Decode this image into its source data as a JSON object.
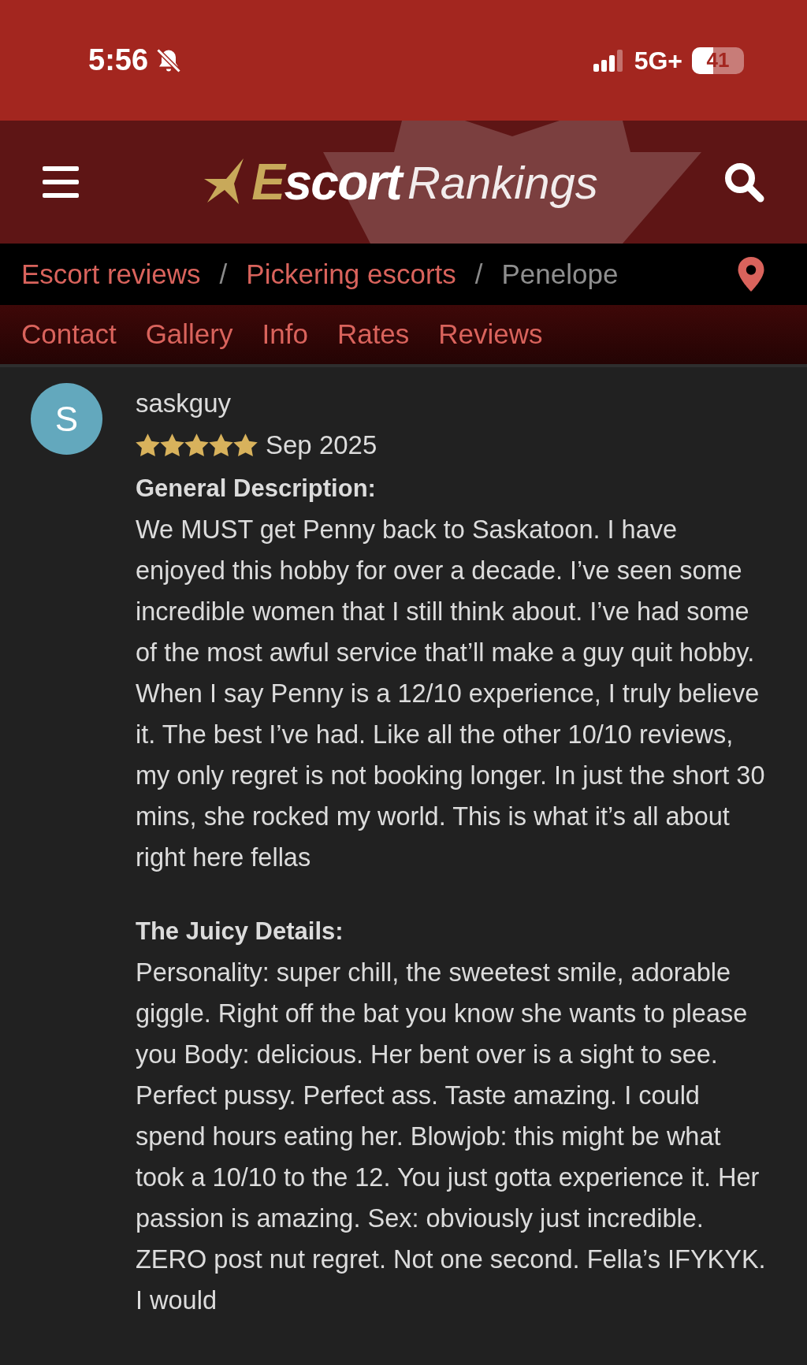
{
  "status_bar": {
    "time": "5:56",
    "network": "5G+",
    "battery": "41"
  },
  "header": {
    "logo_bold": "Escort",
    "logo_light": "Rankings"
  },
  "breadcrumbs": [
    {
      "label": "Escort reviews",
      "current": false
    },
    {
      "label": "Pickering escorts",
      "current": false
    },
    {
      "label": "Penelope",
      "current": true
    }
  ],
  "breadcrumb_separator": "/",
  "tabs": [
    {
      "label": "Contact"
    },
    {
      "label": "Gallery"
    },
    {
      "label": "Info"
    },
    {
      "label": "Rates"
    },
    {
      "label": "Reviews"
    }
  ],
  "review": {
    "avatar_letter": "S",
    "author": "saskguy",
    "stars": 5,
    "date": "Sep 2025",
    "sections": [
      {
        "heading": "General Description:",
        "body": "We MUST get Penny back to Saskatoon. I have enjoyed this hobby for over a decade. I’ve seen some incredible women that I still think about. I’ve had some of the most awful service that’ll make a guy quit hobby. When I say Penny is a 12/10 experience, I truly believe it. The best I’ve had. Like all the other 10/10 reviews, my only regret is not booking longer. In just the short 30 mins, she rocked my world. This is what it’s all about right here fellas"
      },
      {
        "heading": "The Juicy Details:",
        "body": "Personality: super chill, the sweetest smile, adorable giggle. Right off the bat you know she wants to please you Body: delicious. Her bent over is a sight to see. Perfect pussy. Perfect ass. Taste amazing. I could spend hours eating her. Blowjob: this might be what took a 10/10 to the 12. You just gotta experience it. Her passion is amazing. Sex: obviously just incredible. ZERO post nut regret. Not one second. Fella’s IFYKYK. I would"
      }
    ]
  }
}
